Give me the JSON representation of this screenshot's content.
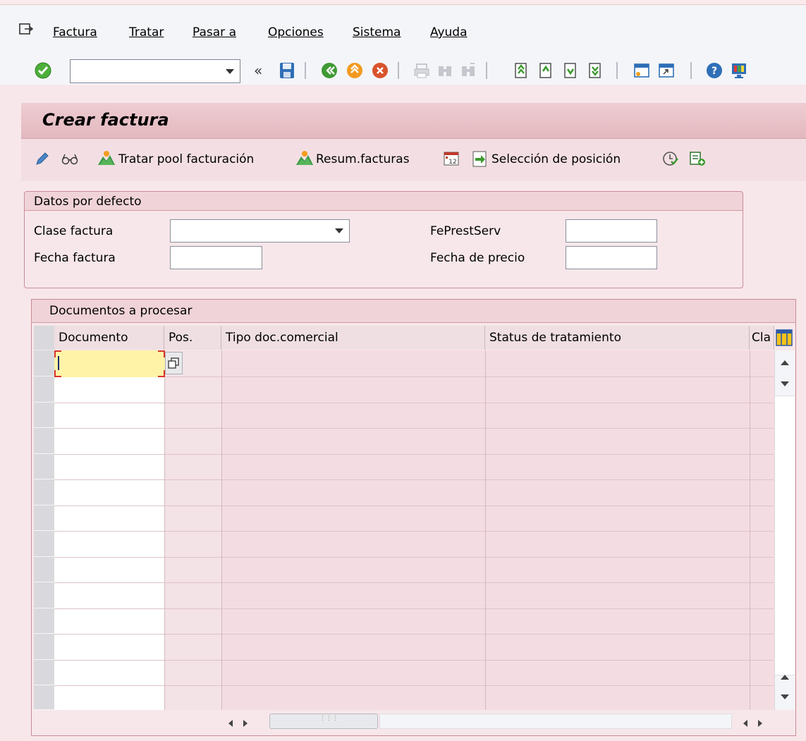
{
  "menu": {
    "items": [
      "Factura",
      "Tratar",
      "Pasar a",
      "Opciones",
      "Sistema",
      "Ayuda"
    ]
  },
  "toolbar": {
    "command_field_value": "",
    "icons": [
      "enter-icon",
      "back-icon",
      "save-icon",
      "back-green-icon",
      "exit-icon",
      "cancel-icon",
      "print-icon",
      "find-icon",
      "find-next-icon",
      "first-page-icon",
      "previous-page-icon",
      "next-page-icon",
      "last-page-icon",
      "create-session-icon",
      "shortcut-icon",
      "help-icon",
      "customize-layout-icon"
    ]
  },
  "page": {
    "title": "Crear factura"
  },
  "app_toolbar": {
    "treat_pool": "Tratar pool facturación",
    "summary": "Resum.facturas",
    "item_selection": "Selección de posición"
  },
  "defaults": {
    "title": "Datos por defecto",
    "billing_type_label": "Clase factura",
    "billing_type_value": "",
    "billing_date_label": "Fecha factura",
    "billing_date_value": "",
    "service_date_label": "FePrestServ",
    "service_date_value": "",
    "pricing_date_label": "Fecha de precio",
    "pricing_date_value": ""
  },
  "documents": {
    "title": "Documentos a procesar",
    "columns": [
      "Documento",
      "Pos.",
      "Tipo doc.comercial",
      "Status de tratamiento",
      "Cla"
    ],
    "row_count": 14
  },
  "colors": {
    "app_background": "#f7e7ea",
    "title_bar": "#e8c0c7",
    "active_cell": "#fff3a8",
    "focus_marker": "#d9342b"
  }
}
